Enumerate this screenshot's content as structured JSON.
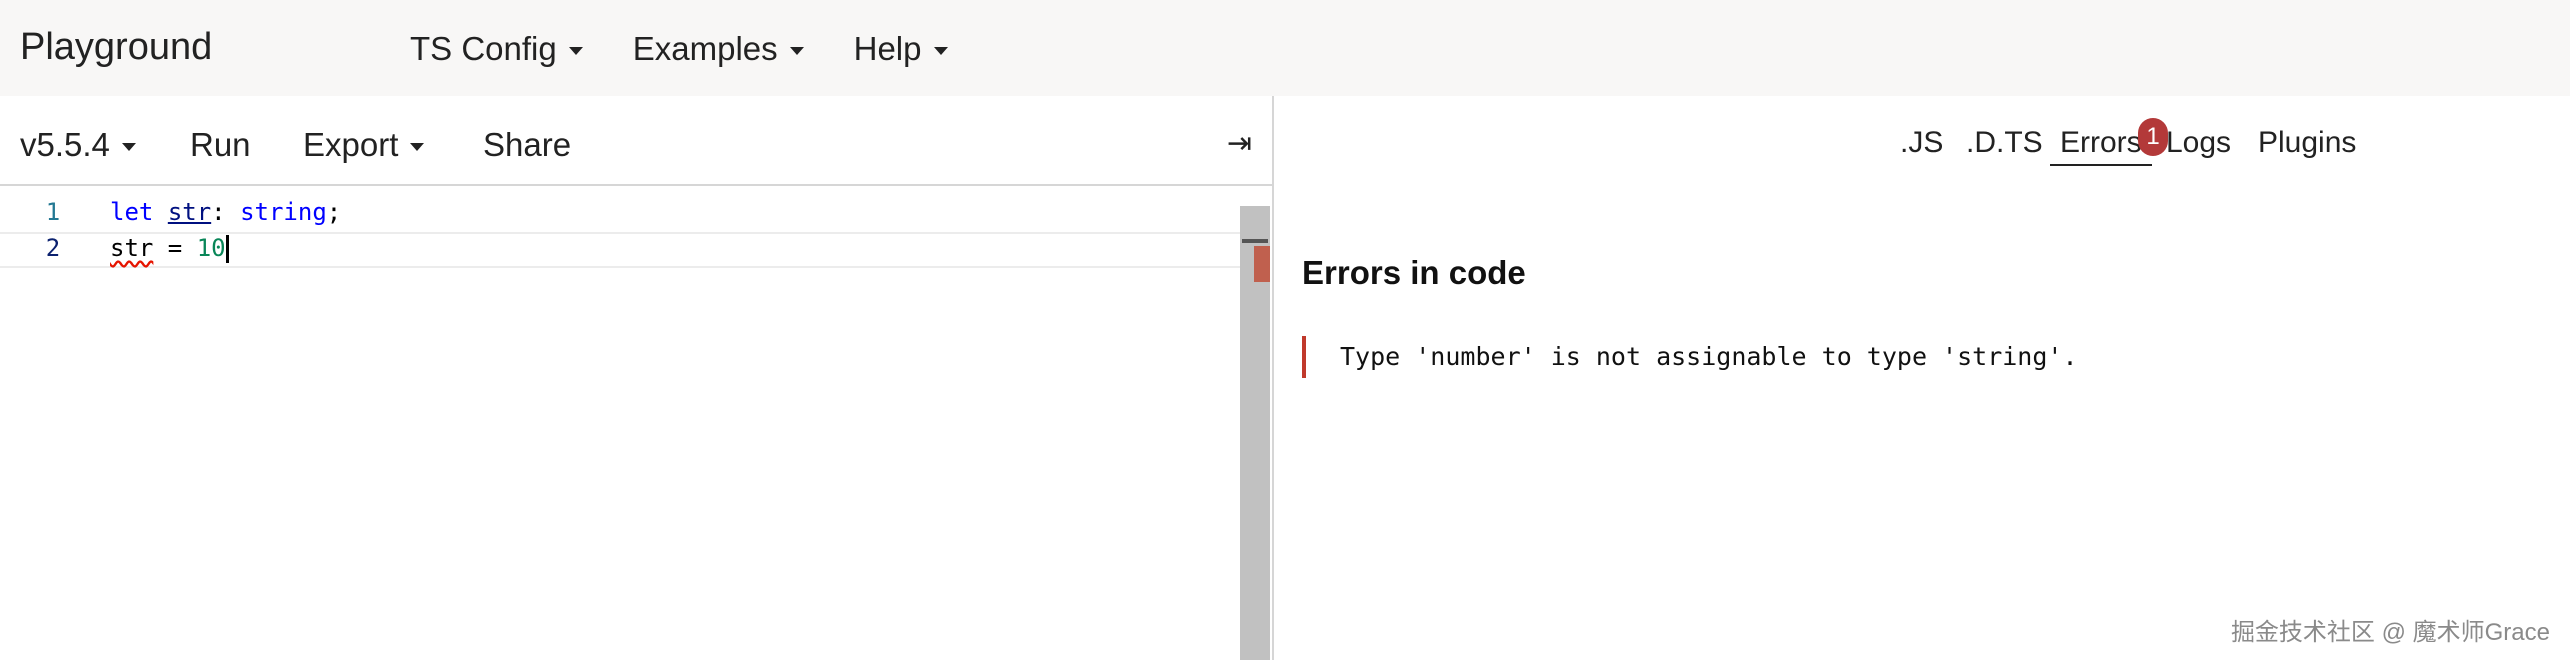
{
  "app": {
    "title": "Playground"
  },
  "topnav": {
    "items": [
      "TS Config",
      "Examples",
      "Help"
    ]
  },
  "editor_toolbar": {
    "version": "v5.5.4",
    "run": "Run",
    "export": "Export",
    "share": "Share",
    "collapse_icon": "⇥"
  },
  "code": {
    "lines": [
      {
        "number": "1",
        "kw": "let",
        "ident": "str",
        "colon": ": ",
        "type": "string",
        "semi": ";"
      },
      {
        "number": "2",
        "ident": "str",
        "op": " = ",
        "value": "10"
      }
    ]
  },
  "output_tabs": {
    "items": [
      ".JS",
      ".D.TS",
      "Errors",
      "Logs",
      "Plugins"
    ],
    "active": "Errors",
    "error_count": "1"
  },
  "errors_panel": {
    "title": "Errors in code",
    "messages": [
      "Type 'number' is not assignable to type 'string'."
    ]
  },
  "watermark": "掘金技术社区 @ 魔术师Grace",
  "colors": {
    "error_accent": "#c0392b",
    "badge": "#b33939"
  }
}
